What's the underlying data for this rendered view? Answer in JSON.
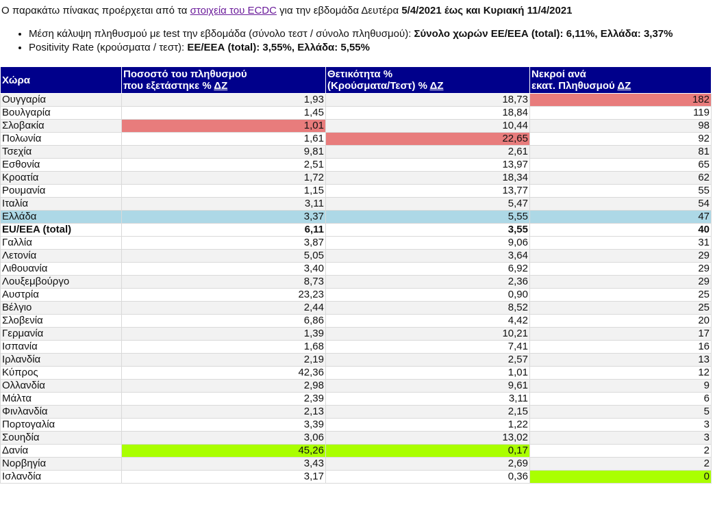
{
  "intro": {
    "text_before": "Ο παρακάτω πίνακας προέρχεται από τα ",
    "link_text": "στοιχεία του ECDC",
    "text_middle": " για την εβδομάδα Δευτέρα ",
    "date_range": "5/4/2021 έως και Κυριακή 11/4/2021"
  },
  "bullets": [
    {
      "label": "Μέση κάλυψη πληθυσμού με test την εβδομάδα (σύνολο τεστ / σύνολο πληθυσμού): ",
      "value": "Σύνολο χωρών ΕΕ/ΕΕΑ (total): 6,11%, Ελλάδα: 3,37%"
    },
    {
      "label": "Positivity Rate (κρούσματα / τεστ): ",
      "value": "ΕΕ/ΕΕΑ (total): 3,55%, Ελλάδα: 5,55%"
    }
  ],
  "table": {
    "headers": {
      "country": "Χώρα",
      "tested_line1": "Ποσοστό του πληθυσμού",
      "tested_line2": "που εξετάστηκε %",
      "positivity_line1": "Θετικότητα %",
      "positivity_line2": "(Κρούσματα/Τεστ) %",
      "deaths_line1": "Νεκροί ανά",
      "deaths_line2": "εκατ. Πληθυσμού",
      "sort_label": "ΔΖ"
    },
    "rows": [
      {
        "country": "Ουγγαρία",
        "tested": "1,93",
        "positivity": "18,73",
        "deaths": "182"
      },
      {
        "country": "Βουλγαρία",
        "tested": "1,45",
        "positivity": "18,84",
        "deaths": "119"
      },
      {
        "country": "Σλοβακία",
        "tested": "1,01",
        "positivity": "10,44",
        "deaths": "98"
      },
      {
        "country": "Πολωνία",
        "tested": "1,61",
        "positivity": "22,65",
        "deaths": "92"
      },
      {
        "country": "Τσεχία",
        "tested": "9,81",
        "positivity": "2,61",
        "deaths": "81"
      },
      {
        "country": "Εσθονία",
        "tested": "2,51",
        "positivity": "13,97",
        "deaths": "65"
      },
      {
        "country": "Κροατία",
        "tested": "1,72",
        "positivity": "18,34",
        "deaths": "62"
      },
      {
        "country": "Ρουμανία",
        "tested": "1,15",
        "positivity": "13,77",
        "deaths": "55"
      },
      {
        "country": "Ιταλία",
        "tested": "3,11",
        "positivity": "5,47",
        "deaths": "54"
      },
      {
        "country": "Ελλάδα",
        "tested": "3,37",
        "positivity": "5,55",
        "deaths": "47"
      },
      {
        "country": "EU/EEA (total)",
        "tested": "6,11",
        "positivity": "3,55",
        "deaths": "40"
      },
      {
        "country": "Γαλλία",
        "tested": "3,87",
        "positivity": "9,06",
        "deaths": "31"
      },
      {
        "country": "Λετονία",
        "tested": "5,05",
        "positivity": "3,64",
        "deaths": "29"
      },
      {
        "country": "Λιθουανία",
        "tested": "3,40",
        "positivity": "6,92",
        "deaths": "29"
      },
      {
        "country": "Λουξεμβούργο",
        "tested": "8,73",
        "positivity": "2,36",
        "deaths": "29"
      },
      {
        "country": "Αυστρία",
        "tested": "23,23",
        "positivity": "0,90",
        "deaths": "25"
      },
      {
        "country": "Βέλγιο",
        "tested": "2,44",
        "positivity": "8,52",
        "deaths": "25"
      },
      {
        "country": "Σλοβενία",
        "tested": "6,86",
        "positivity": "4,42",
        "deaths": "20"
      },
      {
        "country": "Γερμανία",
        "tested": "1,39",
        "positivity": "10,21",
        "deaths": "17"
      },
      {
        "country": "Ισπανία",
        "tested": "1,68",
        "positivity": "7,41",
        "deaths": "16"
      },
      {
        "country": "Ιρλανδία",
        "tested": "2,19",
        "positivity": "2,57",
        "deaths": "13"
      },
      {
        "country": "Κύπρος",
        "tested": "42,36",
        "positivity": "1,01",
        "deaths": "12"
      },
      {
        "country": "Ολλανδία",
        "tested": "2,98",
        "positivity": "9,61",
        "deaths": "9"
      },
      {
        "country": "Μάλτα",
        "tested": "2,39",
        "positivity": "3,11",
        "deaths": "6"
      },
      {
        "country": "Φινλανδία",
        "tested": "2,13",
        "positivity": "2,15",
        "deaths": "5"
      },
      {
        "country": "Πορτογαλία",
        "tested": "3,39",
        "positivity": "1,22",
        "deaths": "3"
      },
      {
        "country": "Σουηδία",
        "tested": "3,06",
        "positivity": "13,02",
        "deaths": "3"
      },
      {
        "country": "Δανία",
        "tested": "45,26",
        "positivity": "0,17",
        "deaths": "2"
      },
      {
        "country": "Νορβηγία",
        "tested": "3,43",
        "positivity": "2,69",
        "deaths": "2"
      },
      {
        "country": "Ισλανδία",
        "tested": "3,17",
        "positivity": "0,36",
        "deaths": "0"
      }
    ]
  },
  "colors": {
    "header_bg": "#00008b",
    "highlight_max": "#e87c7c",
    "highlight_min": "#aaff00",
    "greece_row": "#add8e6",
    "link": "#6a1b9a"
  }
}
